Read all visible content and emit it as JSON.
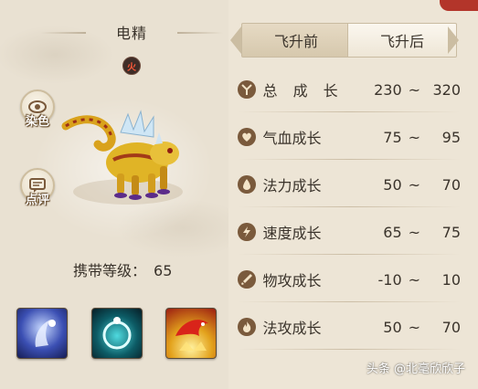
{
  "pet": {
    "name": "电精",
    "element": "火",
    "carry_level_label": "携带等级：",
    "carry_level_value": "65"
  },
  "side_buttons": {
    "dye": "染色",
    "review": "点评"
  },
  "tabs": {
    "before": "飞升前",
    "after": "飞升后"
  },
  "stats": [
    {
      "name": "总 成 长",
      "min": "230",
      "sep": "~",
      "max": "320",
      "icon": "total-growth-icon"
    },
    {
      "name": "气血成长",
      "min": "75",
      "sep": "~",
      "max": "95",
      "icon": "hp-growth-icon"
    },
    {
      "name": "法力成长",
      "min": "50",
      "sep": "~",
      "max": "70",
      "icon": "mana-growth-icon"
    },
    {
      "name": "速度成长",
      "min": "65",
      "sep": "~",
      "max": "75",
      "icon": "speed-growth-icon"
    },
    {
      "name": "物攻成长",
      "min": "-10",
      "sep": "~",
      "max": "10",
      "icon": "physical-attack-growth-icon"
    },
    {
      "name": "法攻成长",
      "min": "50",
      "sep": "~",
      "max": "70",
      "icon": "magic-attack-growth-icon"
    }
  ],
  "skills": [
    "skill-icon-spirit-hand",
    "skill-icon-teal-ring",
    "skill-icon-phoenix"
  ],
  "watermark": "头条 @北毫欣欣子",
  "colors": {
    "text": "#3a332b",
    "accent": "#7a5a3c",
    "flag": "#b3352a"
  }
}
